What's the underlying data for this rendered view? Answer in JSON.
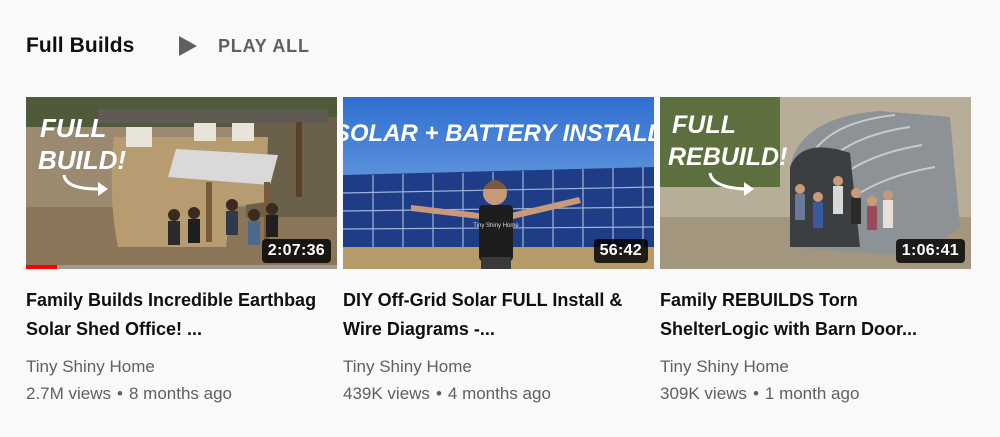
{
  "shelf": {
    "title": "Full Builds",
    "play_all_label": "PLAY ALL",
    "play_icon": "play-icon"
  },
  "videos": [
    {
      "title": "Family Builds Incredible Earthbag Solar Shed Office! ...",
      "duration": "2:07:36",
      "channel": "Tiny Shiny Home",
      "views": "2.7M views",
      "age": "8 months ago",
      "thumbnail_text": [
        "FULL",
        "BUILD!"
      ],
      "watch_progress": 0.1
    },
    {
      "title": "DIY Off-Grid Solar FULL Install & Wire Diagrams -...",
      "duration": "56:42",
      "channel": "Tiny Shiny Home",
      "views": "439K views",
      "age": "4 months ago",
      "thumbnail_text": [
        "SOLAR + BATTERY INSTALL"
      ],
      "shirt_text": "Tiny Shiny Home"
    },
    {
      "title": "Family REBUILDS Torn ShelterLogic with Barn Door...",
      "duration": "1:06:41",
      "channel": "Tiny Shiny Home",
      "views": "309K views",
      "age": "1 month ago",
      "thumbnail_text": [
        "FULL",
        "REBUILD!"
      ]
    }
  ],
  "separator": "•",
  "colors": {
    "background": "#f9f9f9",
    "title_text": "#0f0f0f",
    "secondary_text": "#606060",
    "progress_red": "#ff0000"
  }
}
